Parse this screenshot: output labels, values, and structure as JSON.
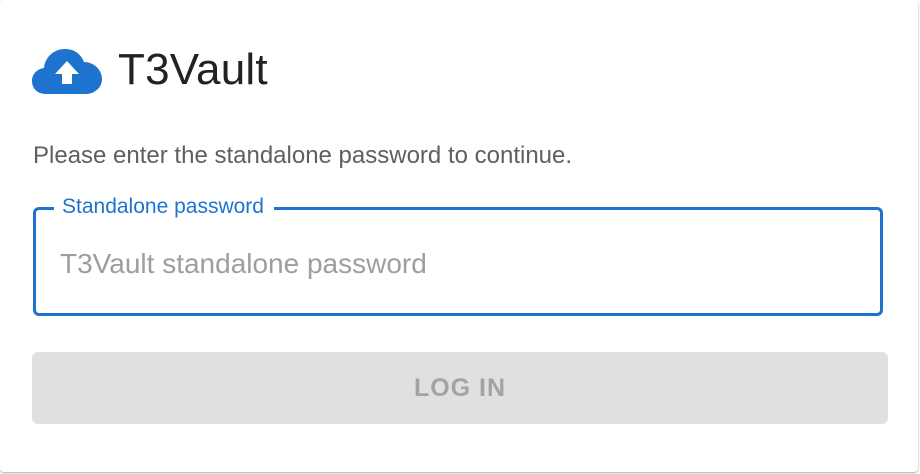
{
  "app": {
    "title": "T3Vault",
    "logo_icon": "cloud-upload-icon",
    "accent_color": "#1e73cf"
  },
  "login": {
    "instructions": "Please enter the standalone password to continue.",
    "password_field": {
      "label": "Standalone password",
      "placeholder": "T3Vault standalone password",
      "value": ""
    },
    "submit_label": "LOG IN",
    "submit_disabled": true
  }
}
